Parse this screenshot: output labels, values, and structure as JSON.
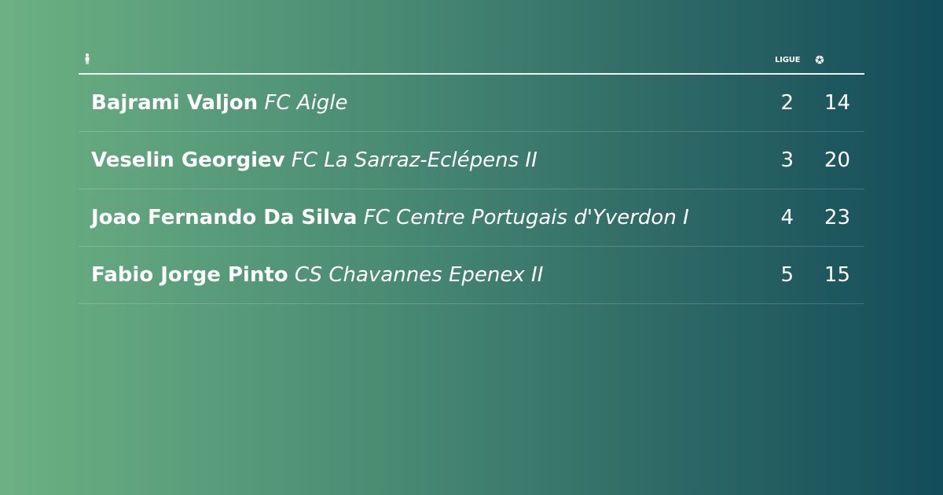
{
  "header": {
    "player_icon": "person-icon",
    "league_label": "LIGUE",
    "goals_icon": "soccer-ball-icon"
  },
  "rows": [
    {
      "player": "Bajrami Valjon",
      "club": "FC Aigle",
      "league": "2",
      "goals": "14"
    },
    {
      "player": "Veselin Georgiev",
      "club": "FC La Sarraz-Eclépens II",
      "league": "3",
      "goals": "20"
    },
    {
      "player": "Joao Fernando Da Silva",
      "club": "FC Centre Portugais d'Yverdon I",
      "league": "4",
      "goals": "23"
    },
    {
      "player": "Fabio Jorge Pinto",
      "club": "CS Chavannes Epenex II",
      "league": "5",
      "goals": "15"
    }
  ],
  "colors": {
    "gradient_start": "#6cb083",
    "gradient_end": "#134c5a",
    "text": "#ffffff"
  }
}
